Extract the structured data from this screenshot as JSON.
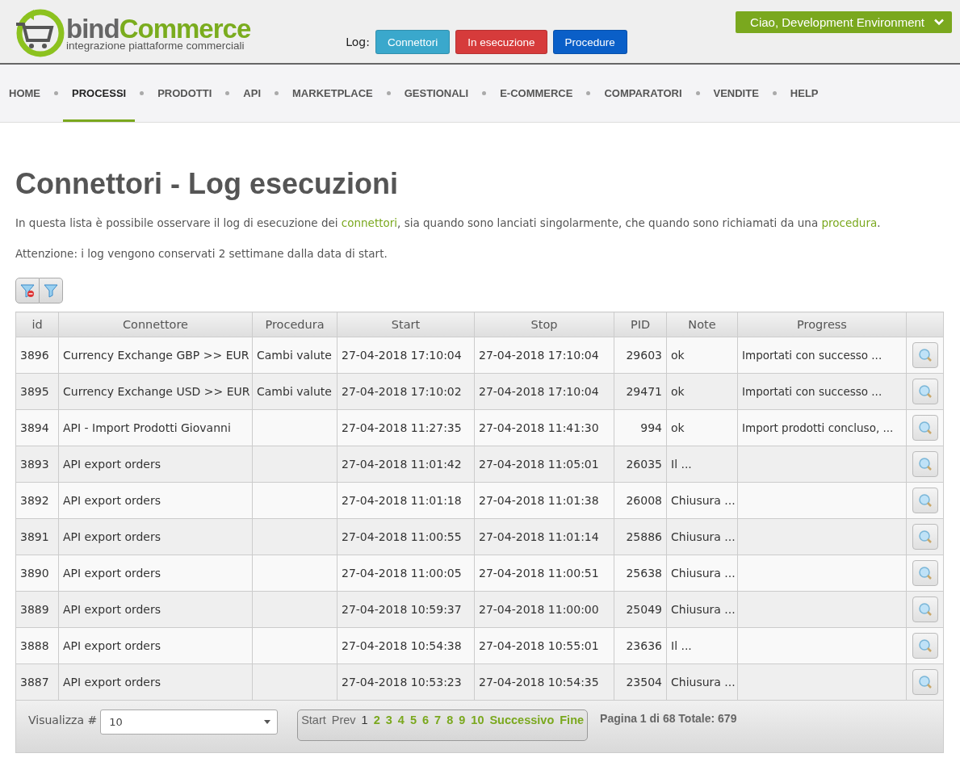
{
  "header": {
    "logo": {
      "name_part1": "bind",
      "name_part2": "Commerce",
      "tagline": "integrazione piattaforme commerciali"
    },
    "log_label": "Log:",
    "log_buttons": [
      {
        "label": "Connettori",
        "color": "#3aa8cc"
      },
      {
        "label": "In esecuzione",
        "color": "#d63b3b"
      },
      {
        "label": "Procedure",
        "color": "#0a5fc8"
      }
    ],
    "user_menu": "Ciao, Development Environment"
  },
  "nav": [
    {
      "label": "HOME",
      "selected": false
    },
    {
      "label": "PROCESSI",
      "selected": true
    },
    {
      "label": "PRODOTTI",
      "selected": false
    },
    {
      "label": "API",
      "selected": false
    },
    {
      "label": "MARKETPLACE",
      "selected": false
    },
    {
      "label": "GESTIONALI",
      "selected": false
    },
    {
      "label": "E-COMMERCE",
      "selected": false
    },
    {
      "label": "COMPARATORI",
      "selected": false
    },
    {
      "label": "VENDITE",
      "selected": false
    },
    {
      "label": "HELP",
      "selected": false
    }
  ],
  "page": {
    "title": "Connettori - Log esecuzioni",
    "intro": [
      {
        "kind": "text",
        "text": "In questa lista è possibile osservare il log di esecuzione dei "
      },
      {
        "kind": "link",
        "text": "connettori"
      },
      {
        "kind": "text",
        "text": ", sia quando sono lanciati singolarmente, che quando sono richiamati da una "
      },
      {
        "kind": "link",
        "text": "procedura"
      },
      {
        "kind": "text",
        "text": "."
      }
    ],
    "notice": "Attenzione: i log vengono conservati 2 settimane dalla data di start."
  },
  "table": {
    "columns": [
      "id",
      "Connettore",
      "Procedura",
      "Start",
      "Stop",
      "PID",
      "Note",
      "Progress"
    ],
    "rows": [
      [
        "3896",
        "Currency Exchange GBP >> EUR",
        "Cambi valute",
        "27-04-2018 17:10:04",
        "27-04-2018 17:10:04",
        "29603",
        "ok",
        "Importati con successo ..."
      ],
      [
        "3895",
        "Currency Exchange USD >> EUR",
        "Cambi valute",
        "27-04-2018 17:10:02",
        "27-04-2018 17:10:04",
        "29471",
        "ok",
        "Importati con successo ..."
      ],
      [
        "3894",
        "API - Import Prodotti Giovanni",
        "",
        "27-04-2018 11:27:35",
        "27-04-2018 11:41:30",
        "994",
        "ok",
        "Import prodotti concluso, ..."
      ],
      [
        "3893",
        "API export orders",
        "",
        "27-04-2018 11:01:42",
        "27-04-2018 11:05:01",
        "26035",
        "Il ...",
        ""
      ],
      [
        "3892",
        "API export orders",
        "",
        "27-04-2018 11:01:18",
        "27-04-2018 11:01:38",
        "26008",
        "Chiusura ...",
        ""
      ],
      [
        "3891",
        "API export orders",
        "",
        "27-04-2018 11:00:55",
        "27-04-2018 11:01:14",
        "25886",
        "Chiusura ...",
        ""
      ],
      [
        "3890",
        "API export orders",
        "",
        "27-04-2018 11:00:05",
        "27-04-2018 11:00:51",
        "25638",
        "Chiusura ...",
        ""
      ],
      [
        "3889",
        "API export orders",
        "",
        "27-04-2018 10:59:37",
        "27-04-2018 11:00:00",
        "25049",
        "Chiusura ...",
        ""
      ],
      [
        "3888",
        "API export orders",
        "",
        "27-04-2018 10:54:38",
        "27-04-2018 10:55:01",
        "23636",
        "Il ...",
        ""
      ],
      [
        "3887",
        "API export orders",
        "",
        "27-04-2018 10:53:23",
        "27-04-2018 10:54:35",
        "23504",
        "Chiusura ...",
        ""
      ]
    ]
  },
  "footer": {
    "page_size_label": "Visualizza #",
    "page_size": "10",
    "pager": [
      {
        "kind": "nav",
        "label": "Start",
        "disabled": true
      },
      {
        "kind": "nav",
        "label": "Prev",
        "disabled": true
      },
      {
        "kind": "page",
        "label": "1",
        "selected": true
      },
      {
        "kind": "page",
        "label": "2",
        "selected": false
      },
      {
        "kind": "page",
        "label": "3",
        "selected": false
      },
      {
        "kind": "page",
        "label": "4",
        "selected": false
      },
      {
        "kind": "page",
        "label": "5",
        "selected": false
      },
      {
        "kind": "page",
        "label": "6",
        "selected": false
      },
      {
        "kind": "page",
        "label": "7",
        "selected": false
      },
      {
        "kind": "page",
        "label": "8",
        "selected": false
      },
      {
        "kind": "page",
        "label": "9",
        "selected": false
      },
      {
        "kind": "page",
        "label": "10",
        "selected": false
      },
      {
        "kind": "nav",
        "label": "Successivo",
        "disabled": false
      },
      {
        "kind": "nav",
        "label": "Fine",
        "disabled": false
      }
    ],
    "summary": "Pagina 1 di 68 Totale: 679"
  }
}
